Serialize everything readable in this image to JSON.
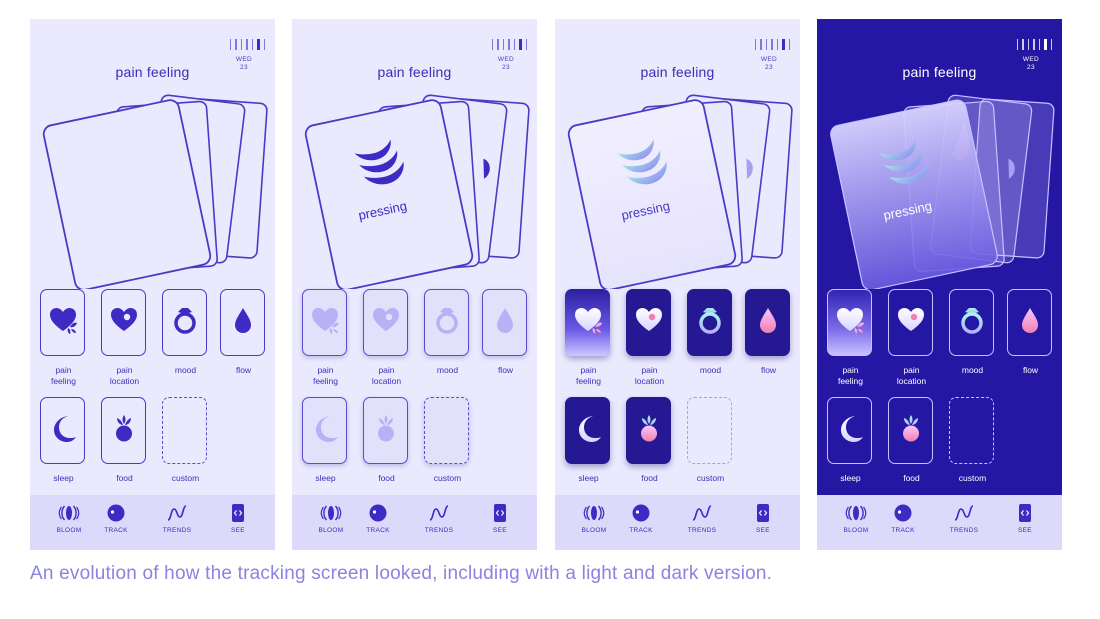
{
  "screens": [
    {
      "id": "v1",
      "theme": "light",
      "title": "pain feeling",
      "date_day": "WED",
      "date_num": "23",
      "card_label": "",
      "items": [
        {
          "label": "pain\nfeeling",
          "icon": "heart-leaf-icon"
        },
        {
          "label": "pain\nlocation",
          "icon": "heart-dot-icon"
        },
        {
          "label": "mood",
          "icon": "ring-icon"
        },
        {
          "label": "flow",
          "icon": "drop-icon"
        },
        {
          "label": "sleep",
          "icon": "moon-icon"
        },
        {
          "label": "food",
          "icon": "berry-icon"
        },
        {
          "label": "custom",
          "icon": "empty-slot"
        }
      ]
    },
    {
      "id": "v2",
      "theme": "light",
      "title": "pain feeling",
      "date_day": "WED",
      "date_num": "23",
      "card_label": "pressing",
      "items": [
        {
          "label": "pain\nfeeling",
          "icon": "heart-leaf-icon"
        },
        {
          "label": "pain\nlocation",
          "icon": "heart-dot-icon"
        },
        {
          "label": "mood",
          "icon": "ring-icon"
        },
        {
          "label": "flow",
          "icon": "drop-icon"
        },
        {
          "label": "sleep",
          "icon": "moon-icon"
        },
        {
          "label": "food",
          "icon": "berry-icon"
        },
        {
          "label": "custom",
          "icon": "empty-slot"
        }
      ]
    },
    {
      "id": "v3",
      "theme": "light",
      "title": "pain feeling",
      "date_day": "WED",
      "date_num": "23",
      "card_label": "pressing",
      "items": [
        {
          "label": "pain\nfeeling",
          "icon": "heart-leaf-icon"
        },
        {
          "label": "pain\nlocation",
          "icon": "heart-dot-icon"
        },
        {
          "label": "mood",
          "icon": "ring-icon"
        },
        {
          "label": "flow",
          "icon": "drop-icon"
        },
        {
          "label": "sleep",
          "icon": "moon-icon"
        },
        {
          "label": "food",
          "icon": "berry-icon"
        },
        {
          "label": "custom",
          "icon": "empty-slot"
        }
      ]
    },
    {
      "id": "v4",
      "theme": "dark",
      "title": "pain feeling",
      "date_day": "WED",
      "date_num": "23",
      "card_label": "pressing",
      "items": [
        {
          "label": "pain\nfeeling",
          "icon": "heart-leaf-icon"
        },
        {
          "label": "pain\nlocation",
          "icon": "heart-dot-icon"
        },
        {
          "label": "mood",
          "icon": "ring-icon"
        },
        {
          "label": "flow",
          "icon": "drop-icon"
        },
        {
          "label": "sleep",
          "icon": "moon-icon"
        },
        {
          "label": "food",
          "icon": "berry-icon"
        },
        {
          "label": "custom",
          "icon": "empty-slot"
        }
      ]
    }
  ],
  "nav": [
    {
      "label": "BLOOM",
      "icon": "bloom-icon"
    },
    {
      "label": "TRACK",
      "icon": "track-icon"
    },
    {
      "label": "TRENDS",
      "icon": "trends-icon"
    },
    {
      "label": "SEE",
      "icon": "see-icon"
    }
  ],
  "caption": "An evolution of how the tracking screen looked, including with a light and dark version.",
  "colors": {
    "primary": "#3d2cc4",
    "light_bg": "#ebe9fd",
    "dark_bg": "#2417a4",
    "caption": "#8a83e0",
    "accent_pink": "#f39ac0",
    "accent_teal": "#8ef0e0"
  }
}
